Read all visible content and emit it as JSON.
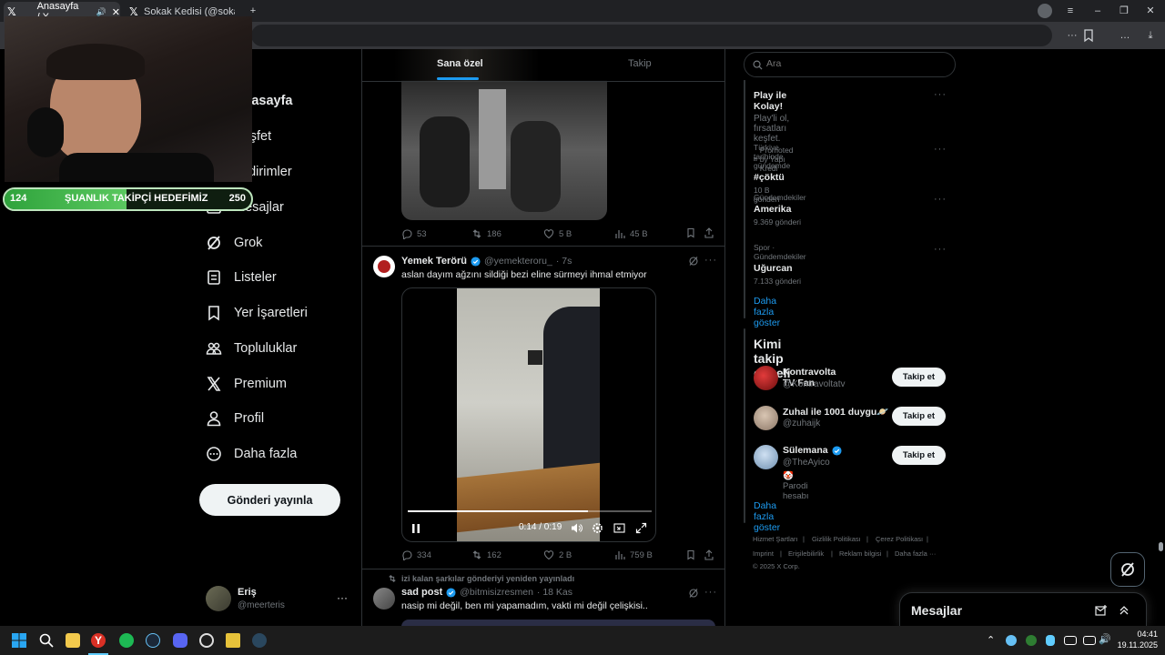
{
  "browser": {
    "tabs": [
      {
        "title": "Anasayfa / X",
        "active": true
      },
      {
        "title": "Sokak Kedisi (@sokakkedi",
        "active": false
      }
    ]
  },
  "overlay": {
    "follower_current": "124",
    "follower_label": "ŞUANLIK TAKİPÇİ HEDEFİMİZ",
    "follower_goal": "250"
  },
  "nav": {
    "items": [
      {
        "label": "Anasayfa",
        "icon": "home-icon"
      },
      {
        "label": "Keşfet",
        "icon": "search-icon"
      },
      {
        "label": "Bildirimler",
        "icon": "bell-icon"
      },
      {
        "label": "Mesajlar",
        "icon": "mail-icon"
      },
      {
        "label": "Grok",
        "icon": "grok-icon"
      },
      {
        "label": "Listeler",
        "icon": "list-icon"
      },
      {
        "label": "Yer İşaretleri",
        "icon": "bookmark-icon"
      },
      {
        "label": "Topluluklar",
        "icon": "people-icon"
      },
      {
        "label": "Premium",
        "icon": "x-icon"
      },
      {
        "label": "Profil",
        "icon": "person-icon"
      },
      {
        "label": "Daha fazla",
        "icon": "more-circle-icon"
      }
    ],
    "post_button": "Gönderi yayınla",
    "account": {
      "name": "Eriş",
      "handle": "@meerteris"
    }
  },
  "feed": {
    "tabs": [
      "Sana özel",
      "Takip"
    ],
    "tweet1_actions": {
      "replies": "53",
      "reposts": "186",
      "likes": "5 B",
      "views": "45 B"
    },
    "tweet2": {
      "name": "Yemek Terörü",
      "handle": "@yemekteroru_",
      "time": "· 7s",
      "text": "aslan dayım ağzını sildiği bezi eline sürmeyi ihmal etmiyor",
      "video_time": "0:14 / 0:19",
      "video_progress": 0.74,
      "actions": {
        "replies": "334",
        "reposts": "162",
        "likes": "2 B",
        "views": "759 B"
      }
    },
    "tweet3": {
      "repost_note": "izi kalan şarkılar gönderiyi yeniden yayınladı",
      "name": "sad post",
      "handle": "@bitmisizresmen",
      "time": "· 18 Kas",
      "text": "nasip mi değil, ben mi yapamadım, vakti mi değil çelişkisi.."
    }
  },
  "sidebar": {
    "search_placeholder": "Ara",
    "trends": [
      {
        "kind": "ad",
        "title": "Play ile Kolay!",
        "sub": "Play'li ol, fırsatları keşfet.",
        "promo": "Promoted by Yapı Kredi"
      },
      {
        "context": "Türkiye tarihinde gündemde",
        "title": "#çöktü",
        "count": "10 B gönderi"
      },
      {
        "context": "Gündemdekiler",
        "title": "Amerika",
        "count": "9.369 gönderi"
      },
      {
        "context": "Spor · Gündemdekiler",
        "title": "Uğurcan",
        "count": "7.133 gönderi"
      }
    ],
    "show_more": "Daha fazla göster",
    "who_to_follow_title": "Kimi takip etmeli",
    "who_to_follow": [
      {
        "name": "Kontravolta TV Fan",
        "handle": "@Kontravoltatv",
        "button": "Takip et"
      },
      {
        "name": "Zuhal ile 1001 duygu🪐",
        "handle": "@zuhaijk",
        "button": "Takip et"
      },
      {
        "name": "Sülemana",
        "handle": "@TheAyico",
        "badge": "🤡 Parodi hesabı",
        "button": "Takip et"
      }
    ],
    "show_more_2": "Daha fazla göster",
    "footer_links": [
      "Hizmet Şartları",
      "Gizlilik Politikası",
      "Çerez Politikası",
      "Imprint",
      "Erişilebilirlik",
      "Reklam bilgisi",
      "Daha fazla ···"
    ],
    "copyright": "© 2025 X Corp."
  },
  "messages_drawer": {
    "title": "Mesajlar"
  },
  "taskbar": {
    "time": "04:41",
    "date": "19.11.2025"
  },
  "colors": {
    "accent": "#1d9bf0",
    "background": "#000000",
    "border": "#2f3336",
    "muted": "#71767b"
  }
}
